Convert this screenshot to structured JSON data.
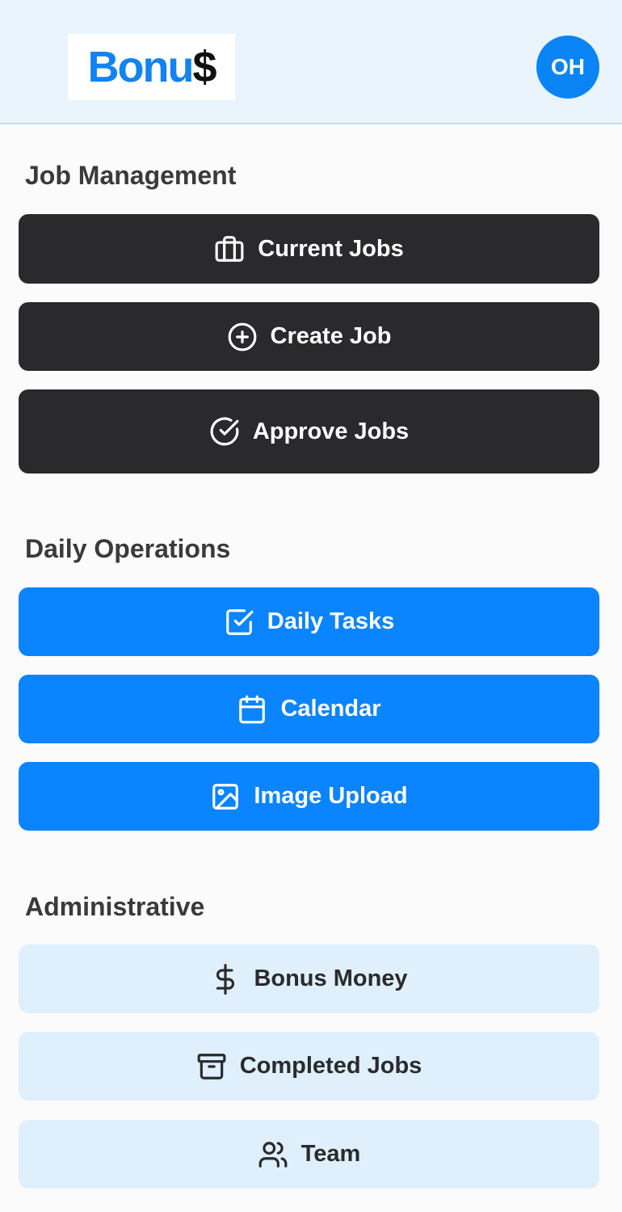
{
  "header": {
    "logo_main": "Bonu",
    "logo_accent": "$",
    "avatar_initials": "OH",
    "colors": {
      "brand_blue": "#0a84ff",
      "header_bg": "#eaf4fd"
    }
  },
  "sections": {
    "job_management": {
      "title": "Job Management",
      "items": [
        {
          "label": "Current Jobs",
          "icon": "briefcase-icon"
        },
        {
          "label": "Create Job",
          "icon": "plus-circle-icon"
        },
        {
          "label": "Approve Jobs",
          "icon": "check-circle-icon"
        }
      ]
    },
    "daily_operations": {
      "title": "Daily Operations",
      "items": [
        {
          "label": "Daily Tasks",
          "icon": "check-square-icon"
        },
        {
          "label": "Calendar",
          "icon": "calendar-icon"
        },
        {
          "label": "Image Upload",
          "icon": "image-icon"
        }
      ]
    },
    "administrative": {
      "title": "Administrative",
      "items": [
        {
          "label": "Bonus Money",
          "icon": "dollar-icon"
        },
        {
          "label": "Completed Jobs",
          "icon": "archive-icon"
        },
        {
          "label": "Team",
          "icon": "users-icon"
        }
      ]
    }
  }
}
